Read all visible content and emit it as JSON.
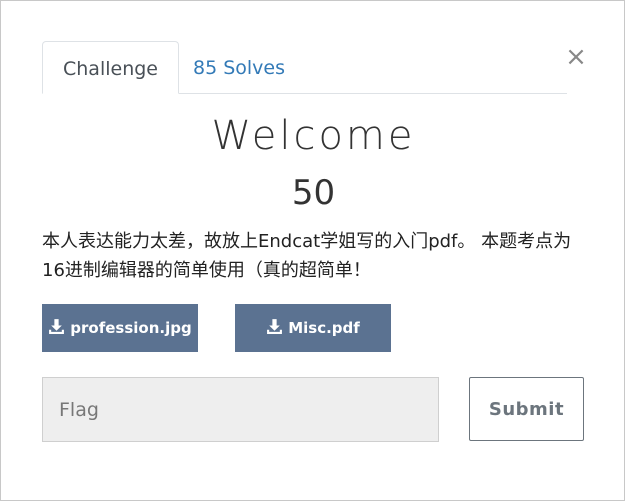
{
  "tabs": {
    "challenge_label": "Challenge",
    "solves_label": "85 Solves"
  },
  "close_label": "×",
  "challenge": {
    "name": "Welcome",
    "points": "50",
    "description": "本人表达能力太差，故放上Endcat学姐写的入门pdf。 本题考点为16进制编辑器的简单使用（真的超简单！"
  },
  "files": [
    {
      "label": "profession.jpg",
      "icon": "download-icon"
    },
    {
      "label": "Misc.pdf",
      "icon": "download-icon"
    }
  ],
  "flag_input": {
    "placeholder": "Flag",
    "value": ""
  },
  "submit_label": "Submit",
  "colors": {
    "file_button_bg": "#5b7291",
    "tab_link": "#337ab7",
    "input_bg": "#eeeeee"
  }
}
